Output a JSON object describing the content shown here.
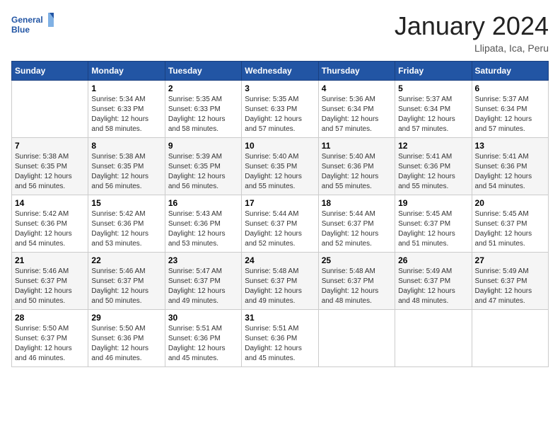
{
  "logo": {
    "general": "General",
    "blue": "Blue"
  },
  "title": "January 2024",
  "location": "Llipata, Ica, Peru",
  "days_of_week": [
    "Sunday",
    "Monday",
    "Tuesday",
    "Wednesday",
    "Thursday",
    "Friday",
    "Saturday"
  ],
  "weeks": [
    [
      {
        "day": "",
        "info": ""
      },
      {
        "day": "1",
        "info": "Sunrise: 5:34 AM\nSunset: 6:33 PM\nDaylight: 12 hours\nand 58 minutes."
      },
      {
        "day": "2",
        "info": "Sunrise: 5:35 AM\nSunset: 6:33 PM\nDaylight: 12 hours\nand 58 minutes."
      },
      {
        "day": "3",
        "info": "Sunrise: 5:35 AM\nSunset: 6:33 PM\nDaylight: 12 hours\nand 57 minutes."
      },
      {
        "day": "4",
        "info": "Sunrise: 5:36 AM\nSunset: 6:34 PM\nDaylight: 12 hours\nand 57 minutes."
      },
      {
        "day": "5",
        "info": "Sunrise: 5:37 AM\nSunset: 6:34 PM\nDaylight: 12 hours\nand 57 minutes."
      },
      {
        "day": "6",
        "info": "Sunrise: 5:37 AM\nSunset: 6:34 PM\nDaylight: 12 hours\nand 57 minutes."
      }
    ],
    [
      {
        "day": "7",
        "info": "Sunrise: 5:38 AM\nSunset: 6:35 PM\nDaylight: 12 hours\nand 56 minutes."
      },
      {
        "day": "8",
        "info": "Sunrise: 5:38 AM\nSunset: 6:35 PM\nDaylight: 12 hours\nand 56 minutes."
      },
      {
        "day": "9",
        "info": "Sunrise: 5:39 AM\nSunset: 6:35 PM\nDaylight: 12 hours\nand 56 minutes."
      },
      {
        "day": "10",
        "info": "Sunrise: 5:40 AM\nSunset: 6:35 PM\nDaylight: 12 hours\nand 55 minutes."
      },
      {
        "day": "11",
        "info": "Sunrise: 5:40 AM\nSunset: 6:36 PM\nDaylight: 12 hours\nand 55 minutes."
      },
      {
        "day": "12",
        "info": "Sunrise: 5:41 AM\nSunset: 6:36 PM\nDaylight: 12 hours\nand 55 minutes."
      },
      {
        "day": "13",
        "info": "Sunrise: 5:41 AM\nSunset: 6:36 PM\nDaylight: 12 hours\nand 54 minutes."
      }
    ],
    [
      {
        "day": "14",
        "info": "Sunrise: 5:42 AM\nSunset: 6:36 PM\nDaylight: 12 hours\nand 54 minutes."
      },
      {
        "day": "15",
        "info": "Sunrise: 5:42 AM\nSunset: 6:36 PM\nDaylight: 12 hours\nand 53 minutes."
      },
      {
        "day": "16",
        "info": "Sunrise: 5:43 AM\nSunset: 6:36 PM\nDaylight: 12 hours\nand 53 minutes."
      },
      {
        "day": "17",
        "info": "Sunrise: 5:44 AM\nSunset: 6:37 PM\nDaylight: 12 hours\nand 52 minutes."
      },
      {
        "day": "18",
        "info": "Sunrise: 5:44 AM\nSunset: 6:37 PM\nDaylight: 12 hours\nand 52 minutes."
      },
      {
        "day": "19",
        "info": "Sunrise: 5:45 AM\nSunset: 6:37 PM\nDaylight: 12 hours\nand 51 minutes."
      },
      {
        "day": "20",
        "info": "Sunrise: 5:45 AM\nSunset: 6:37 PM\nDaylight: 12 hours\nand 51 minutes."
      }
    ],
    [
      {
        "day": "21",
        "info": "Sunrise: 5:46 AM\nSunset: 6:37 PM\nDaylight: 12 hours\nand 50 minutes."
      },
      {
        "day": "22",
        "info": "Sunrise: 5:46 AM\nSunset: 6:37 PM\nDaylight: 12 hours\nand 50 minutes."
      },
      {
        "day": "23",
        "info": "Sunrise: 5:47 AM\nSunset: 6:37 PM\nDaylight: 12 hours\nand 49 minutes."
      },
      {
        "day": "24",
        "info": "Sunrise: 5:48 AM\nSunset: 6:37 PM\nDaylight: 12 hours\nand 49 minutes."
      },
      {
        "day": "25",
        "info": "Sunrise: 5:48 AM\nSunset: 6:37 PM\nDaylight: 12 hours\nand 48 minutes."
      },
      {
        "day": "26",
        "info": "Sunrise: 5:49 AM\nSunset: 6:37 PM\nDaylight: 12 hours\nand 48 minutes."
      },
      {
        "day": "27",
        "info": "Sunrise: 5:49 AM\nSunset: 6:37 PM\nDaylight: 12 hours\nand 47 minutes."
      }
    ],
    [
      {
        "day": "28",
        "info": "Sunrise: 5:50 AM\nSunset: 6:37 PM\nDaylight: 12 hours\nand 46 minutes."
      },
      {
        "day": "29",
        "info": "Sunrise: 5:50 AM\nSunset: 6:36 PM\nDaylight: 12 hours\nand 46 minutes."
      },
      {
        "day": "30",
        "info": "Sunrise: 5:51 AM\nSunset: 6:36 PM\nDaylight: 12 hours\nand 45 minutes."
      },
      {
        "day": "31",
        "info": "Sunrise: 5:51 AM\nSunset: 6:36 PM\nDaylight: 12 hours\nand 45 minutes."
      },
      {
        "day": "",
        "info": ""
      },
      {
        "day": "",
        "info": ""
      },
      {
        "day": "",
        "info": ""
      }
    ]
  ]
}
